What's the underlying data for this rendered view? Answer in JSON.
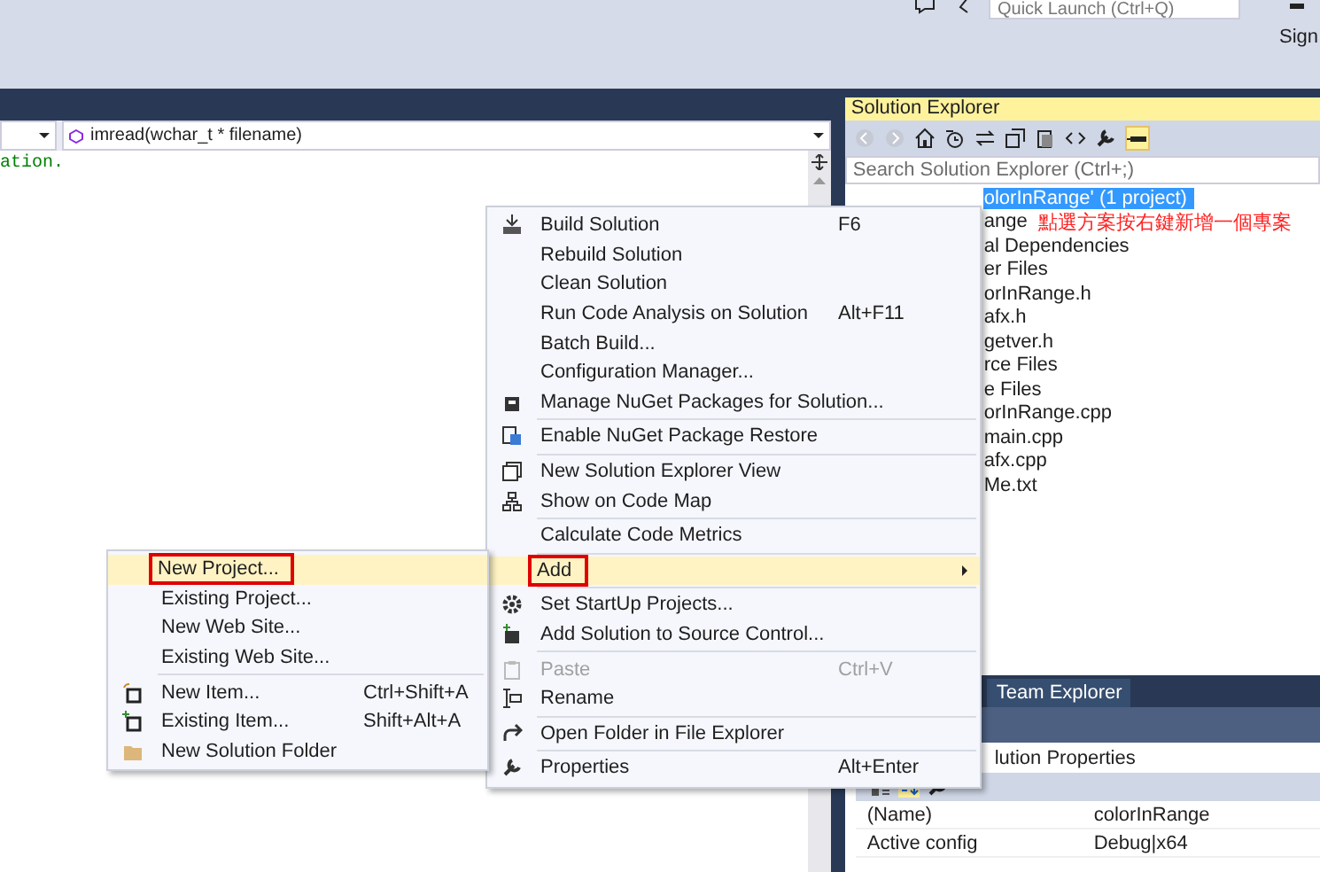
{
  "title_bar": {
    "quick_launch": {
      "placeholder": "Quick Launch (Ctrl+Q)"
    },
    "sign_in": "Sign"
  },
  "editor": {
    "member_combo": "imread(wchar_t * filename)",
    "code_lines": [
      "ation."
    ]
  },
  "solution_explorer": {
    "title": "Solution Explorer",
    "search": {
      "placeholder": "Search Solution Explorer (Ctrl+;)"
    },
    "tree": [
      {
        "label": "olorInRange' (1 project)",
        "selected": true
      },
      {
        "label": "ange",
        "selected": false
      },
      {
        "label": "al Dependencies",
        "selected": false
      },
      {
        "label": "er Files",
        "selected": false
      },
      {
        "label": "orInRange.h",
        "selected": false
      },
      {
        "label": "afx.h",
        "selected": false
      },
      {
        "label": "getver.h",
        "selected": false
      },
      {
        "label": "rce Files",
        "selected": false
      },
      {
        "label": "e Files",
        "selected": false
      },
      {
        "label": "orInRange.cpp",
        "selected": false
      },
      {
        "label": "main.cpp",
        "selected": false
      },
      {
        "label": "afx.cpp",
        "selected": false
      },
      {
        "label": "Me.txt",
        "selected": false
      }
    ],
    "annotation": "點選方案按右鍵新增一個專案"
  },
  "bottom_tabs": [
    {
      "label": "Team Explorer",
      "selected": false
    }
  ],
  "properties": {
    "title": "lution Properties",
    "rows": [
      {
        "name": "(Name)",
        "value": "colorInRange"
      },
      {
        "name": "Active config",
        "value": "Debug|x64"
      }
    ]
  },
  "context_menu": [
    {
      "kind": "item",
      "label": "Build Solution",
      "shortcut": "F6",
      "selected": false,
      "disabled": false,
      "annotated": false
    },
    {
      "kind": "item",
      "label": "Rebuild Solution",
      "selected": false,
      "disabled": false,
      "annotated": false
    },
    {
      "kind": "item",
      "label": "Clean Solution",
      "selected": false,
      "disabled": false,
      "annotated": false
    },
    {
      "kind": "item",
      "label": "Run Code Analysis on Solution",
      "shortcut": "Alt+F11",
      "selected": false,
      "disabled": false,
      "annotated": false
    },
    {
      "kind": "item",
      "label": "Batch Build...",
      "selected": false,
      "disabled": false,
      "annotated": false
    },
    {
      "kind": "item",
      "label": "Configuration Manager...",
      "selected": false,
      "disabled": false,
      "annotated": false
    },
    {
      "kind": "item",
      "label": "Manage NuGet Packages for Solution...",
      "selected": false,
      "disabled": false,
      "annotated": false
    },
    {
      "kind": "separator"
    },
    {
      "kind": "item",
      "label": "Enable NuGet Package Restore",
      "selected": false,
      "disabled": false,
      "annotated": false
    },
    {
      "kind": "separator"
    },
    {
      "kind": "item",
      "label": "New Solution Explorer View",
      "selected": false,
      "disabled": false,
      "annotated": false
    },
    {
      "kind": "item",
      "label": "Show on Code Map",
      "selected": false,
      "disabled": false,
      "annotated": false
    },
    {
      "kind": "separator"
    },
    {
      "kind": "item",
      "label": "Calculate Code Metrics",
      "selected": false,
      "disabled": false,
      "annotated": false
    },
    {
      "kind": "separator"
    },
    {
      "kind": "submenu",
      "label": "Add",
      "selected": true,
      "disabled": false,
      "annotated": true
    },
    {
      "kind": "separator"
    },
    {
      "kind": "item",
      "label": "Set StartUp Projects...",
      "selected": false,
      "disabled": false,
      "annotated": false
    },
    {
      "kind": "item",
      "label": "Add Solution to Source Control...",
      "selected": false,
      "disabled": false,
      "annotated": false
    },
    {
      "kind": "separator"
    },
    {
      "kind": "item",
      "label": "Paste",
      "shortcut": "Ctrl+V",
      "selected": false,
      "disabled": true,
      "annotated": false
    },
    {
      "kind": "item",
      "label": "Rename",
      "selected": false,
      "disabled": false,
      "annotated": false
    },
    {
      "kind": "separator"
    },
    {
      "kind": "item",
      "label": "Open Folder in File Explorer",
      "selected": false,
      "disabled": false,
      "annotated": false
    },
    {
      "kind": "separator"
    },
    {
      "kind": "item",
      "label": "Properties",
      "shortcut": "Alt+Enter",
      "selected": false,
      "disabled": false,
      "annotated": false
    }
  ],
  "add_submenu": [
    {
      "kind": "item",
      "label": "New Project...",
      "selected": true,
      "disabled": false,
      "annotated": true
    },
    {
      "kind": "item",
      "label": "Existing Project...",
      "selected": false,
      "disabled": false,
      "annotated": false
    },
    {
      "kind": "item",
      "label": "New Web Site...",
      "selected": false,
      "disabled": false,
      "annotated": false
    },
    {
      "kind": "item",
      "label": "Existing Web Site...",
      "selected": false,
      "disabled": false,
      "annotated": false
    },
    {
      "kind": "separator"
    },
    {
      "kind": "item",
      "label": "New Item...",
      "shortcut": "Ctrl+Shift+A",
      "selected": false,
      "disabled": false,
      "annotated": false
    },
    {
      "kind": "item",
      "label": "Existing Item...",
      "shortcut": "Shift+Alt+A",
      "selected": false,
      "disabled": false,
      "annotated": false
    },
    {
      "kind": "item",
      "label": "New Solution Folder",
      "selected": false,
      "disabled": false,
      "annotated": false
    }
  ]
}
